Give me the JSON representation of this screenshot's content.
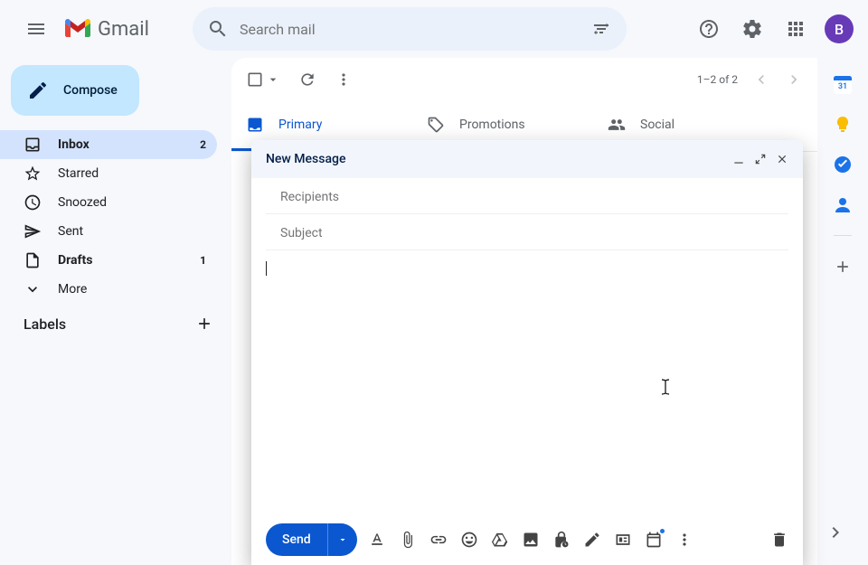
{
  "header": {
    "app_name": "Gmail",
    "search_placeholder": "Search mail",
    "avatar_initial": "B"
  },
  "sidebar": {
    "compose_label": "Compose",
    "items": [
      {
        "label": "Inbox",
        "count": "2",
        "active": true,
        "bold": true
      },
      {
        "label": "Starred"
      },
      {
        "label": "Snoozed"
      },
      {
        "label": "Sent"
      },
      {
        "label": "Drafts",
        "count": "1",
        "bold": true
      },
      {
        "label": "More"
      }
    ],
    "labels_header": "Labels"
  },
  "toolbar": {
    "pagination": "1–2 of 2"
  },
  "tabs": [
    {
      "label": "Primary",
      "active": true
    },
    {
      "label": "Promotions"
    },
    {
      "label": "Social"
    }
  ],
  "compose": {
    "title": "New Message",
    "recipients_placeholder": "Recipients",
    "subject_placeholder": "Subject",
    "send_label": "Send"
  },
  "right_panel": {
    "calendar_day": "31"
  }
}
